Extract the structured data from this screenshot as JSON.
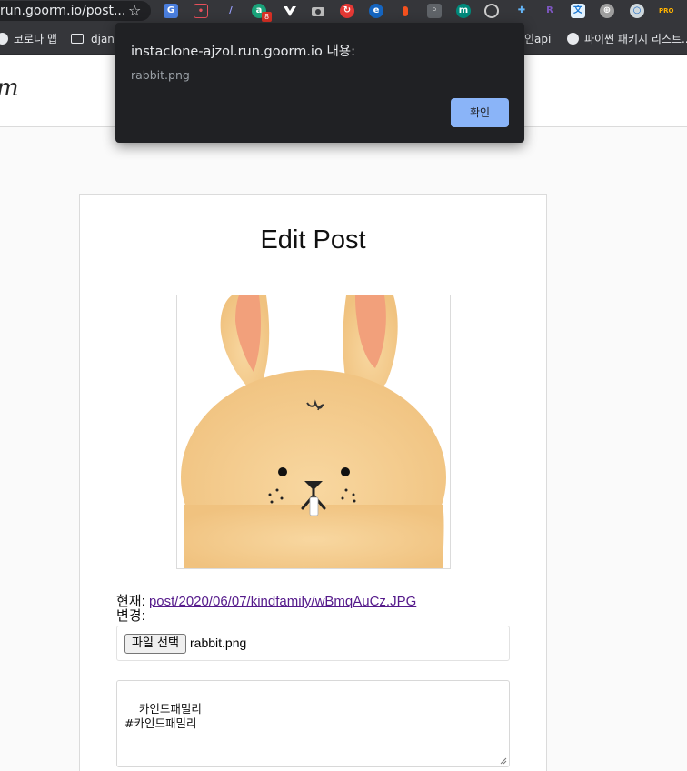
{
  "browser": {
    "url": "run.goorm.io/post...",
    "extensions": [
      "google-translate-icon",
      "pocket-icon",
      "pen-icon",
      "grammarly-icon",
      "vue-devtools-icon",
      "camera-icon",
      "sync-icon",
      "edge-icon",
      "bottle-icon",
      "bulb-icon",
      "m-icon",
      "target-icon",
      "puzzle-icon",
      "r-icon",
      "translate-icon",
      "globe-icon",
      "loop-icon",
      "pro-icon"
    ],
    "badge_count": "8",
    "bookmarks": [
      {
        "label": "코로나 맵",
        "icon": "globe-icon"
      },
      {
        "label": "djang",
        "icon": "folder-icon"
      },
      {
        "label": "인api",
        "icon": "none"
      },
      {
        "label": "파이썬 패키지 리스트...",
        "icon": "globe-icon"
      }
    ]
  },
  "header": {
    "logo": "m"
  },
  "dialog": {
    "title": "instaclone-ajzol.run.goorm.io 내용:",
    "message": "rabbit.png",
    "ok_label": "확인",
    "ok_color": "#8ab4f8"
  },
  "form": {
    "title": "Edit Post",
    "current_label": "현재:",
    "current_file": "post/2020/06/07/kindfamily/wBmqAuCz.JPG",
    "change_label": "변경:",
    "file_button": "파일 선택",
    "file_name": "rabbit.png",
    "caption": "카인드패밀리\n#카인드패밀리"
  }
}
